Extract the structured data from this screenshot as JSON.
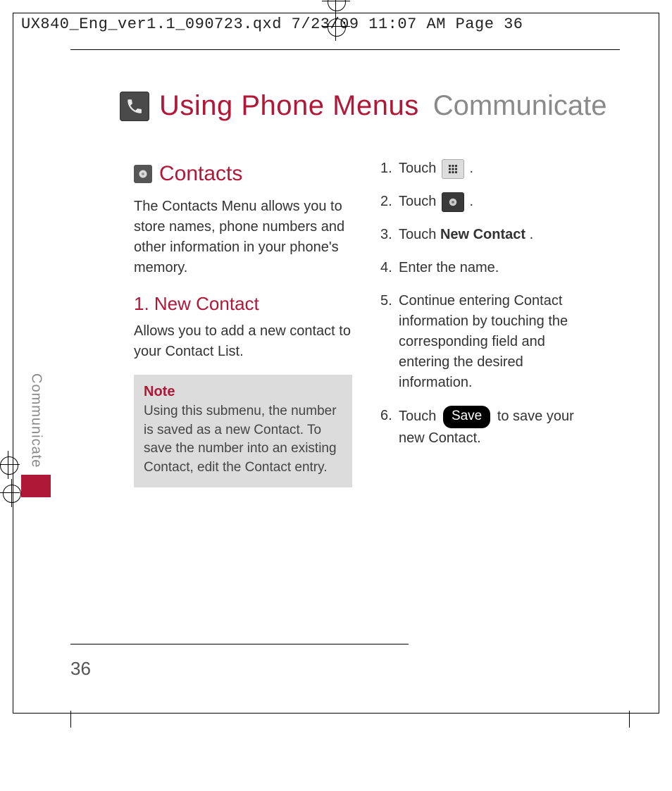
{
  "meta_header": "UX840_Eng_ver1.1_090723.qxd  7/23/09  11:07 AM  Page 36",
  "page_number": "36",
  "title": {
    "main": "Using Phone Menus",
    "sub": "Communicate"
  },
  "side_label": "Communicate",
  "left": {
    "section_title": "Contacts",
    "intro": "The Contacts Menu allows you to store names, phone numbers and other information in your phone's memory.",
    "subhead": "1. New Contact",
    "subbody": "Allows you to add a new contact to your Contact List.",
    "note_label": "Note",
    "note_body": "Using this submenu, the number is saved as a new Contact. To save the number into an existing Contact, edit the Contact entry."
  },
  "right": {
    "steps": {
      "s1_a": "Touch ",
      "s1_b": ".",
      "s2_a": "Touch ",
      "s2_b": ".",
      "s3_a": "Touch ",
      "s3_bold": "New Contact",
      "s3_b": ".",
      "s4": "Enter the name.",
      "s5": "Continue entering Contact information by touching the corresponding field and entering the desired information.",
      "s6_a": "Touch ",
      "s6_pill": "Save",
      "s6_b": " to save your new Contact."
    }
  }
}
